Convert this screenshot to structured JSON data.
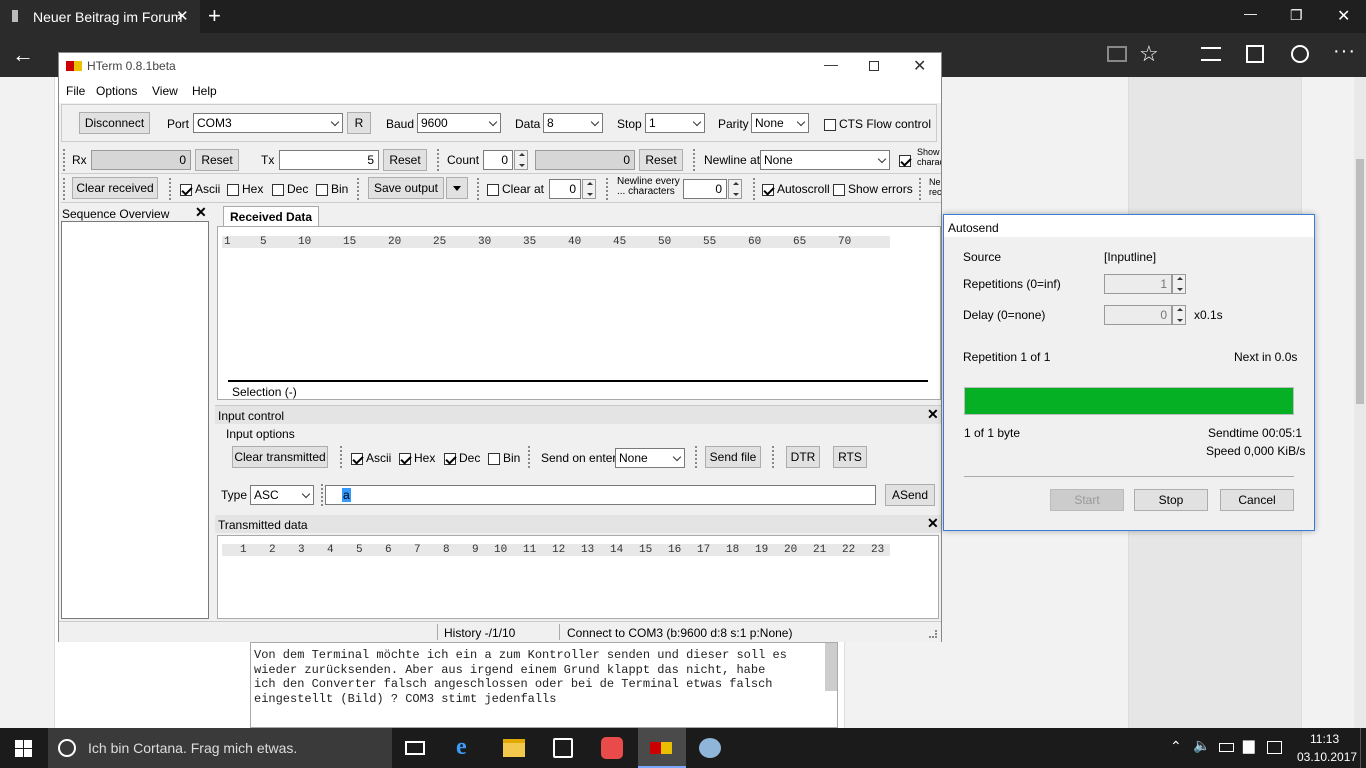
{
  "browser": {
    "tab_title": "Neuer Beitrag im Forum",
    "tab_close": "✕",
    "new_tab": "+",
    "min": "—",
    "restore": "❐",
    "close": "✕",
    "more": "···"
  },
  "hterm": {
    "title": "HTerm 0.8.1beta",
    "menu": [
      "File",
      "Options",
      "View",
      "Help"
    ],
    "conn": {
      "disconnect": "Disconnect",
      "port_label": "Port",
      "port": "COM3",
      "r": "R",
      "baud_label": "Baud",
      "baud": "9600",
      "data_label": "Data",
      "data": "8",
      "stop_label": "Stop",
      "stop": "1",
      "parity_label": "Parity",
      "parity": "None",
      "cts": "CTS Flow control"
    },
    "counters": {
      "rx_label": "Rx",
      "rx_value": "0",
      "tx_label": "Tx",
      "tx_value": "5",
      "reset": "Reset",
      "count_label": "Count",
      "count_value": "0",
      "count_result": "0",
      "newline_label": "Newline at",
      "newline_value": "None",
      "show_label": "Show charac"
    },
    "recv_opts": {
      "clear_received": "Clear received",
      "ascii": "Ascii",
      "hex": "Hex",
      "dec": "Dec",
      "bin": "Bin",
      "save_output": "Save output",
      "clear_at": "Clear at",
      "clear_at_value": "0",
      "newline_every_1": "Newline every",
      "newline_every_2": "... characters",
      "newline_every_value": "0",
      "autoscroll": "Autoscroll",
      "show_errors": "Show errors",
      "ne_1": "Ne",
      "ne_2": "rec"
    },
    "seq_title": "Sequence Overview",
    "recv": {
      "tab": "Received Data",
      "ruler": [
        "1",
        "5",
        "10",
        "15",
        "20",
        "25",
        "30",
        "35",
        "40",
        "45",
        "50",
        "55",
        "60",
        "65",
        "70"
      ],
      "selection": "Selection (-)"
    },
    "input": {
      "title": "Input control",
      "options": "Input options",
      "clear_transmitted": "Clear transmitted",
      "ascii": "Ascii",
      "hex": "Hex",
      "dec": "Dec",
      "bin": "Bin",
      "send_on_enter": "Send on enter",
      "send_on_enter_value": "None",
      "send_file": "Send file",
      "dtr": "DTR",
      "rts": "RTS",
      "type_label": "Type",
      "type_value": "ASC",
      "input_value": "a",
      "asend": "ASend"
    },
    "tx": {
      "title": "Transmitted data",
      "cols": [
        "1",
        "2",
        "3",
        "4",
        "5",
        "6",
        "7",
        "8",
        "9",
        "10",
        "11",
        "12",
        "13",
        "14",
        "15",
        "16",
        "17",
        "18",
        "19",
        "20",
        "21",
        "22",
        "23"
      ]
    },
    "status": {
      "history": "History -/1/10",
      "connect": "Connect to COM3 (b:9600 d:8 s:1 p:None)"
    }
  },
  "autosend": {
    "title": "Autosend",
    "source_label": "Source",
    "source_value": "[Inputline]",
    "rep_label": "Repetitions (0=inf)",
    "rep_value": "1",
    "delay_label": "Delay (0=none)",
    "delay_value": "0",
    "delay_unit": "x0.1s",
    "repetition": "Repetition 1 of 1",
    "next": "Next in 0.0s",
    "progress": 1.0,
    "bytes": "1 of 1 byte",
    "sendtime": "Sendtime 00:05:1",
    "speed": "Speed 0,000 KiB/s",
    "start": "Start",
    "stop": "Stop",
    "cancel": "Cancel"
  },
  "forum_text": [
    "Von dem Terminal möchte ich ein a zum Kontroller senden und dieser soll es",
    "wieder zurücksenden. Aber aus irgend einem Grund klappt das nicht, habe",
    "ich den Converter falsch angeschlossen oder bei de Terminal etwas falsch",
    "eingestellt (Bild) ? COM3 stimt jedenfalls"
  ],
  "taskbar": {
    "cortana": "Ich bin Cortana. Frag mich etwas.",
    "time": "11:13",
    "date": "03.10.2017"
  },
  "colors": {
    "progress": "#06b025",
    "taskbar": "#1b1b1b",
    "browser_bar": "#2b2b2b"
  }
}
